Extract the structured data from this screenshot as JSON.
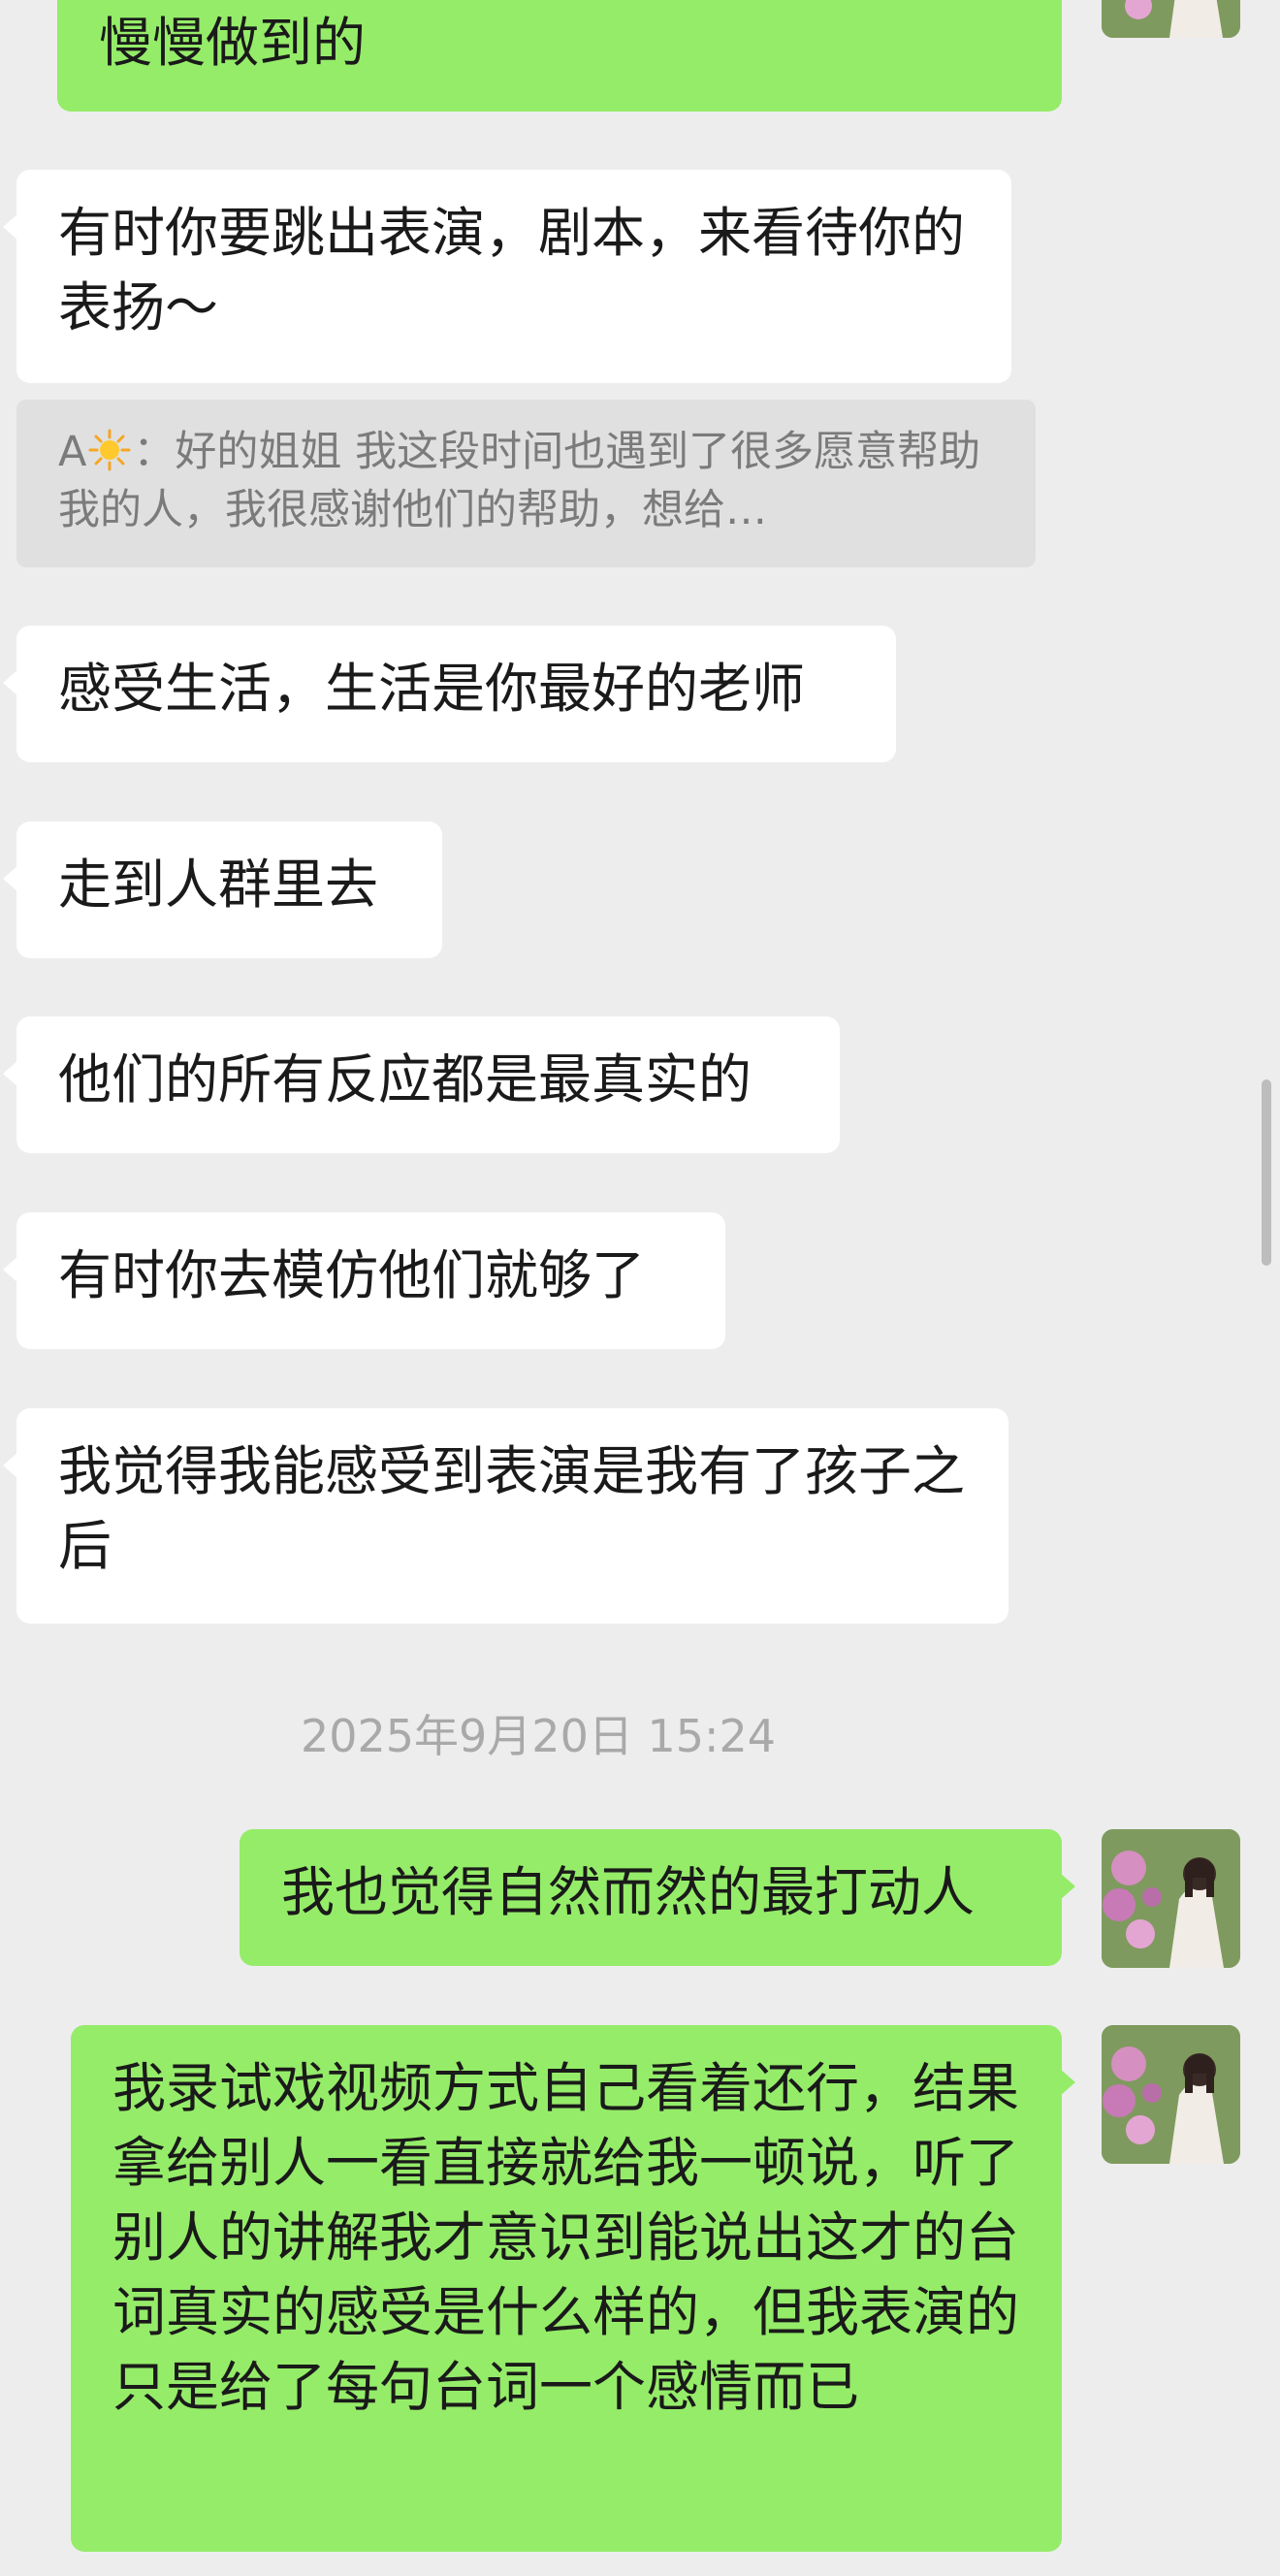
{
  "messages": {
    "m0": "慢慢做到的",
    "m1": "有时你要跳出表演，剧本，来看待你的表扬～",
    "quote_sender": "A",
    "quote_body": "：好的姐姐 我这段时间也遇到了很多愿意帮助我的人，我很感谢他们的帮助，想给…",
    "m2": "感受生活，生活是你最好的老师",
    "m3": "走到人群里去",
    "m4": "他们的所有反应都是最真实的",
    "m5": "有时你去模仿他们就够了",
    "m6": "我觉得我能感受到表演是我有了孩子之后",
    "timestamp": "2025年9月20日 15:24",
    "m7": "我也觉得自然而然的最打动人",
    "m8": "我录试戏视频方式自己看着还行，结果拿给别人一看直接就给我一顿说，听了别人的讲解我才意识到能说出这才的台词真实的感受是什么样的，但我表演的只是给了每句台词一个感情而已"
  },
  "colors": {
    "background": "#ededed",
    "incoming_bubble": "#ffffff",
    "outgoing_bubble": "#95ec69",
    "quote_background": "#e0e0e0",
    "timestamp_text": "#a9a9a9"
  },
  "icons": {
    "quote_emoji": "sun-icon",
    "avatar": "avatar-photo"
  }
}
